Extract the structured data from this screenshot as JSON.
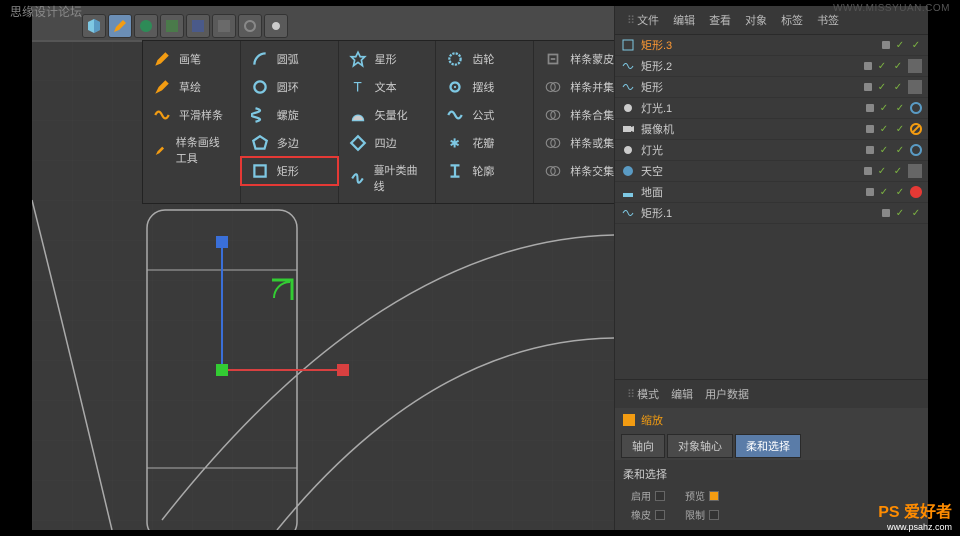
{
  "watermarks": {
    "tl": "思缘设计论坛",
    "tr": "WWW.MISSYUAN.COM",
    "br_logo": "PS 爱好者",
    "br_url": "www.psahz.com"
  },
  "dropdown": {
    "col1": [
      {
        "icon": "pen",
        "label": "画笔"
      },
      {
        "icon": "sketch",
        "label": "草绘"
      },
      {
        "icon": "smooth",
        "label": "平滑样条"
      },
      {
        "icon": "spline-pen",
        "label": "样条画线工具"
      }
    ],
    "col2": [
      {
        "icon": "arc",
        "label": "圆弧"
      },
      {
        "icon": "circle",
        "label": "圆环"
      },
      {
        "icon": "helix",
        "label": "螺旋"
      },
      {
        "icon": "ngon",
        "label": "多边"
      },
      {
        "icon": "rect",
        "label": "矩形",
        "highlighted": true
      }
    ],
    "col3": [
      {
        "icon": "star",
        "label": "星形"
      },
      {
        "icon": "text",
        "label": "文本"
      },
      {
        "icon": "vectorize",
        "label": "矢量化"
      },
      {
        "icon": "4side",
        "label": "四边"
      },
      {
        "icon": "cissoid",
        "label": "蔓叶类曲线"
      }
    ],
    "col4": [
      {
        "icon": "cog",
        "label": "齿轮"
      },
      {
        "icon": "cycloid",
        "label": "摆线"
      },
      {
        "icon": "formula",
        "label": "公式"
      },
      {
        "icon": "flower",
        "label": "花瓣"
      },
      {
        "icon": "profile",
        "label": "轮廓"
      }
    ],
    "col5": [
      {
        "icon": "mask",
        "label": "样条蒙皮"
      },
      {
        "icon": "union",
        "label": "样条并集"
      },
      {
        "icon": "merge",
        "label": "样条合集"
      },
      {
        "icon": "or",
        "label": "样条或集"
      },
      {
        "icon": "intersect",
        "label": "样条交集"
      }
    ]
  },
  "obj_panel": {
    "tabs": [
      "文件",
      "编辑",
      "查看",
      "对象",
      "标签",
      "书签"
    ],
    "items": [
      {
        "icon": "rect",
        "name": "矩形.3",
        "selected": true,
        "badges": [
          "dot",
          "check",
          "check"
        ],
        "tags": []
      },
      {
        "icon": "spline",
        "name": "矩形.2",
        "badges": [
          "dot",
          "check",
          "check"
        ],
        "tags": [
          "tex"
        ]
      },
      {
        "icon": "spline",
        "name": "矩形",
        "badges": [
          "dot",
          "check",
          "check"
        ],
        "tags": [
          "tex"
        ]
      },
      {
        "icon": "light",
        "name": "灯光.1",
        "badges": [
          "dot",
          "check",
          "check"
        ],
        "tags": [
          "ring"
        ]
      },
      {
        "icon": "camera",
        "name": "摄像机",
        "badges": [
          "dot",
          "check",
          "check"
        ],
        "tags": [
          "stop"
        ]
      },
      {
        "icon": "light",
        "name": "灯光",
        "badges": [
          "dot",
          "check",
          "check"
        ],
        "tags": [
          "ring"
        ]
      },
      {
        "icon": "sky",
        "name": "天空",
        "badges": [
          "dot",
          "check",
          "check"
        ],
        "tags": [
          "tex"
        ]
      },
      {
        "icon": "floor",
        "name": "地面",
        "badges": [
          "dot",
          "check",
          "check"
        ],
        "tags": [
          "red"
        ]
      },
      {
        "icon": "spline",
        "name": "矩形.1",
        "badges": [
          "dot",
          "check",
          "check"
        ],
        "tags": []
      }
    ]
  },
  "attr_panel": {
    "tabs": [
      "模式",
      "编辑",
      "用户数据"
    ],
    "title": "缩放",
    "tabs2": [
      {
        "label": "轴向"
      },
      {
        "label": "对象轴心"
      },
      {
        "label": "柔和选择",
        "active": true
      }
    ],
    "section_title": "柔和选择",
    "fields": [
      {
        "label": "启用",
        "checked": false
      },
      {
        "label": "预览",
        "checked": true
      },
      {
        "label": "橡皮",
        "checked": false
      },
      {
        "label": "限制",
        "checked": false
      }
    ]
  }
}
